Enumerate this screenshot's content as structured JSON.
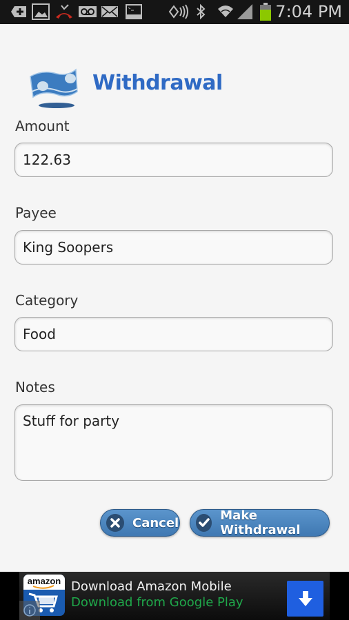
{
  "status_bar": {
    "time": "7:04 PM",
    "icons": [
      "add-notification-icon",
      "gallery-icon",
      "missed-call-icon",
      "voicemail-icon",
      "email-icon",
      "terminal-icon",
      "nfc-icon",
      "bluetooth-icon",
      "wifi-icon",
      "signal-icon",
      "battery-icon"
    ],
    "battery_color": "#8cc800"
  },
  "header": {
    "title": "Withdrawal",
    "icon": "money-bill-icon"
  },
  "form": {
    "amount": {
      "label": "Amount",
      "value": "122.63"
    },
    "payee": {
      "label": "Payee",
      "value": "King Soopers"
    },
    "category": {
      "label": "Category",
      "value": "Food"
    },
    "notes": {
      "label": "Notes",
      "value": "Stuff for party"
    }
  },
  "buttons": {
    "cancel": "Cancel",
    "submit": "Make Withdrawal"
  },
  "ad": {
    "app_logo_text": "amazon",
    "line1": "Download Amazon Mobile",
    "line2": "Download from Google Play"
  },
  "colors": {
    "accent": "#2f6ac4",
    "button": "#4a85c0",
    "ad_green": "#1fa84a",
    "ad_button": "#1f5fe0"
  }
}
